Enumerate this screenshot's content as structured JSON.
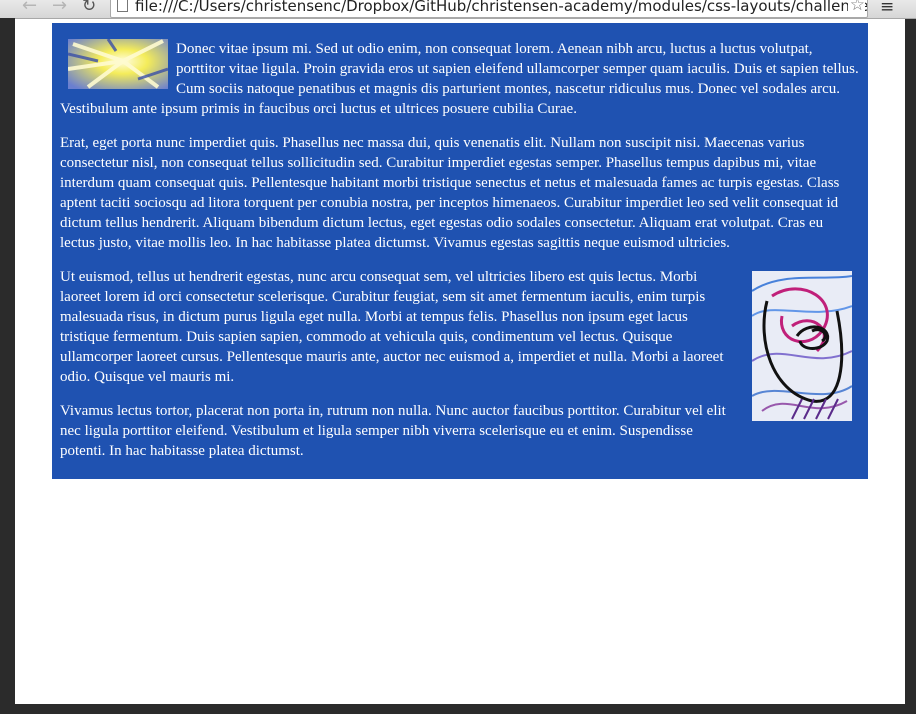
{
  "browser": {
    "url": "file:///C:/Users/christensenc/Dropbox/GitHub/christensen-academy/modules/css-layouts/challenges/text-w",
    "back_glyph": "←",
    "forward_glyph": "→",
    "reload_glyph": "↻",
    "star_glyph": "☆",
    "menu_glyph": "≡"
  },
  "article": {
    "paragraphs": [
      "Donec vitae ipsum mi. Sed ut odio enim, non consequat lorem. Aenean nibh arcu, luctus a luctus volutpat, porttitor vitae ligula. Proin gravida eros ut sapien eleifend ullamcorper semper quam iaculis. Duis et sapien tellus. Cum sociis natoque penatibus et magnis dis parturient montes, nascetur ridiculus mus. Donec vel sodales arcu. Vestibulum ante ipsum primis in faucibus orci luctus et ultrices posuere cubilia Curae.",
      "Erat, eget porta nunc imperdiet quis. Phasellus nec massa dui, quis venenatis elit. Nullam non suscipit nisi. Maecenas varius consectetur nisl, non consequat tellus sollicitudin sed. Curabitur imperdiet egestas semper. Phasellus tempus dapibus mi, vitae interdum quam consequat quis. Pellentesque habitant morbi tristique senectus et netus et malesuada fames ac turpis egestas. Class aptent taciti sociosqu ad litora torquent per conubia nostra, per inceptos himenaeos. Curabitur imperdiet leo sed velit consequat id dictum tellus hendrerit. Aliquam bibendum dictum lectus, eget egestas odio sodales consectetur. Aliquam erat volutpat. Cras eu lectus justo, vitae mollis leo. In hac habitasse platea dictumst. Vivamus egestas sagittis neque euismod ultricies.",
      "Ut euismod, tellus ut hendrerit egestas, nunc arcu consequat sem, vel ultricies libero est quis lectus. Morbi laoreet lorem id orci consectetur scelerisque. Curabitur feugiat, sem sit amet fermentum iaculis, enim turpis malesuada risus, in dictum purus ligula eget nulla. Morbi at tempus felis. Phasellus non ipsum eget lacus tristique fermentum. Duis sapien sapien, commodo at vehicula quis, condimentum vel lectus. Quisque ullamcorper laoreet cursus. Pellentesque mauris ante, auctor nec euismod a, imperdiet et nulla. Morbi a laoreet odio. Quisque vel mauris mi.",
      "Vivamus lectus tortor, placerat non porta in, rutrum non nulla. Nunc auctor faucibus porttitor. Curabitur vel elit nec ligula porttitor eleifend. Vestibulum et ligula semper nibh viverra scelerisque eu et enim. Suspendisse potenti. In hac habitasse platea dictumst."
    ],
    "background_color": "#1f52b1"
  }
}
